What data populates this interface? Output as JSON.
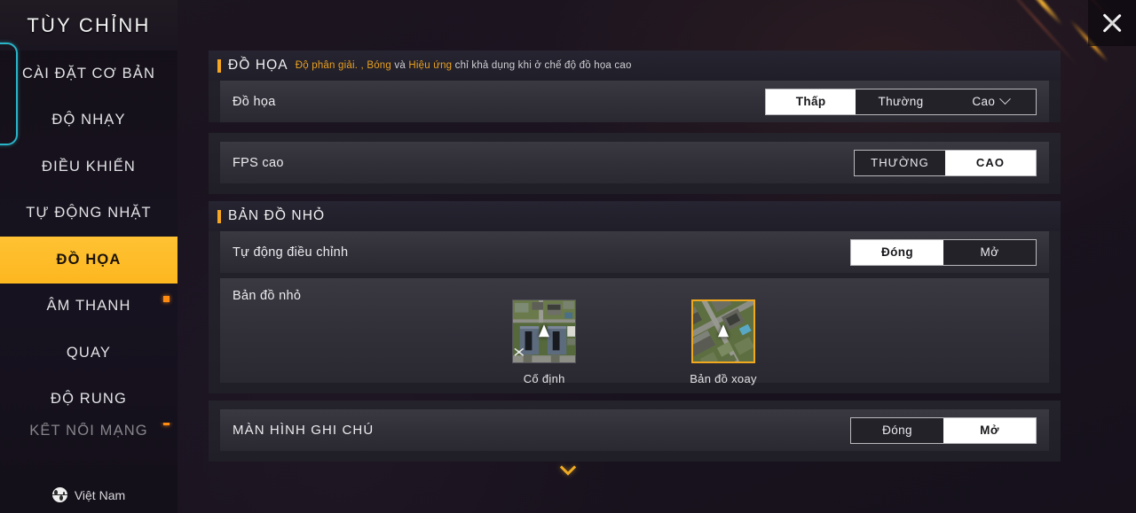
{
  "sidebar": {
    "title": "TÙY CHỈNH",
    "items": [
      {
        "label": "CÀI ĐẶT CƠ BẢN",
        "active": false,
        "badge": false
      },
      {
        "label": "ĐỘ NHẠY",
        "active": false,
        "badge": false
      },
      {
        "label": "ĐIỀU KHIỂN",
        "active": false,
        "badge": false
      },
      {
        "label": "TỰ ĐỘNG NHẶT",
        "active": false,
        "badge": false
      },
      {
        "label": "ĐỒ HỌA",
        "active": true,
        "badge": false
      },
      {
        "label": "ÂM THANH",
        "active": false,
        "badge": true
      },
      {
        "label": "QUAY",
        "active": false,
        "badge": false
      },
      {
        "label": "ĐỘ RUNG",
        "active": false,
        "badge": false
      },
      {
        "label": "KẾT NỐI MẠNG",
        "active": false,
        "badge": true
      }
    ],
    "language": {
      "label": "Việt Nam",
      "icon": "globe-icon"
    }
  },
  "window": {
    "close_icon": "close-icon",
    "scroll_down_icon": "chevron-down-icon"
  },
  "groups": {
    "graphics": {
      "title": "ĐỒ HỌA",
      "note_parts": [
        {
          "text": "Độ phân giải. ,",
          "highlight": true
        },
        {
          "text": " ",
          "highlight": false
        },
        {
          "text": "Bóng",
          "highlight": true
        },
        {
          "text": " và ",
          "highlight": false
        },
        {
          "text": "Hiệu ứng",
          "highlight": true
        },
        {
          "text": " chỉ khả dụng khi ở chế độ đồ họa cao",
          "highlight": false
        }
      ],
      "rows": [
        {
          "label": "Đồ họa",
          "options": [
            "Thấp",
            "Thường",
            "Cao"
          ],
          "selected": "Thấp",
          "has_dropdown": true
        }
      ]
    },
    "fps": {
      "rows": [
        {
          "label": "FPS cao",
          "options": [
            "THƯỜNG",
            "CAO"
          ],
          "selected": "CAO",
          "has_dropdown": false
        }
      ]
    },
    "minimap": {
      "title": "BẢN ĐỒ NHỎ",
      "rows": [
        {
          "label": "Tự động điều chỉnh",
          "options": [
            "Đóng",
            "Mở"
          ],
          "selected": "Đóng",
          "has_dropdown": false
        }
      ],
      "thumb_row_label": "Bản đồ nhỏ",
      "thumbs": [
        {
          "caption": "Cố định",
          "selected": false
        },
        {
          "caption": "Bản đồ xoay",
          "selected": true
        }
      ]
    },
    "notes": {
      "rows": [
        {
          "label": "MÀN HÌNH GHI CHÚ",
          "options": [
            "Đóng",
            "Mở"
          ],
          "selected": "Mở",
          "has_dropdown": false
        }
      ]
    }
  },
  "colors": {
    "accent": "#fdb71f",
    "highlight_text": "#e8a020",
    "badge": "#ff8c10",
    "teal_outline": "#2ab4c8",
    "selected_bg": "#ffffff"
  }
}
